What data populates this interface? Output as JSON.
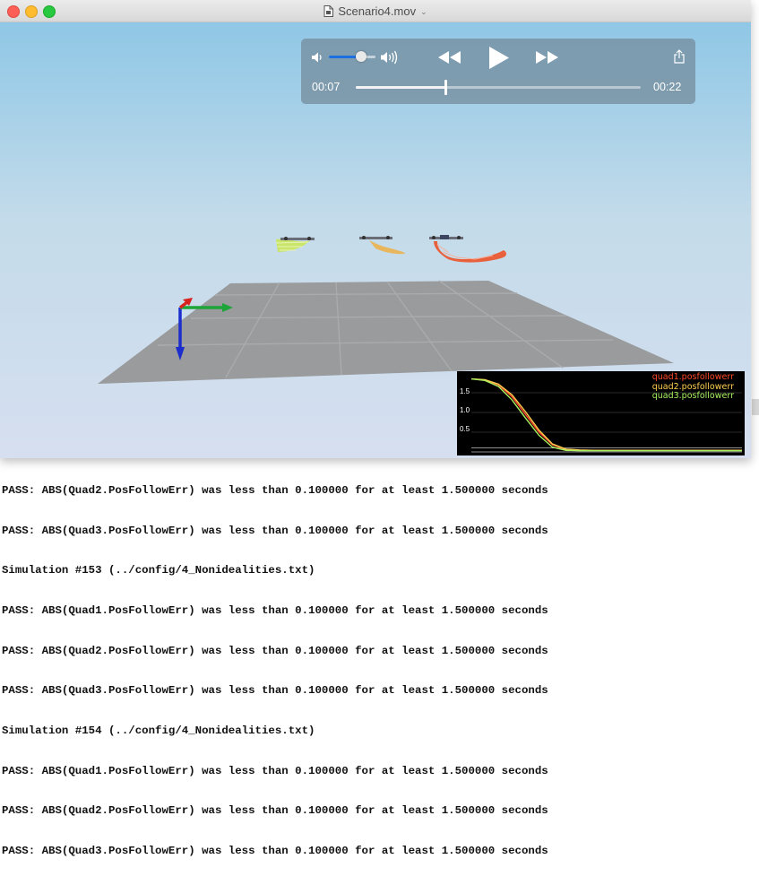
{
  "window": {
    "title": "Scenario4.mov"
  },
  "player": {
    "current_time": "00:07",
    "total_time": "00:22",
    "progress": 0.3158,
    "volume": 0.7
  },
  "plot": {
    "legend": [
      "quad1.posfollowerr",
      "quad2.posfollowerr",
      "quad3.posfollowerr"
    ],
    "legend_colors": [
      "#ff4a2a",
      "#ffd050",
      "#a8f060"
    ],
    "yticks": [
      "1.5",
      "1.0",
      "0.5"
    ]
  },
  "chart_data": {
    "type": "line",
    "title": "",
    "xlabel": "",
    "ylabel": "",
    "ylim": [
      0,
      2
    ],
    "x": [
      0,
      0.05,
      0.1,
      0.15,
      0.2,
      0.25,
      0.3,
      0.35,
      0.4,
      0.45,
      0.5,
      0.6,
      0.7,
      0.8,
      1.0
    ],
    "series": [
      {
        "name": "quad1.posfollowerr",
        "color": "#ff4a2a",
        "values": [
          1.85,
          1.82,
          1.7,
          1.4,
          0.95,
          0.5,
          0.18,
          0.06,
          0.04,
          0.04,
          0.04,
          0.04,
          0.04,
          0.04,
          0.04
        ]
      },
      {
        "name": "quad2.posfollowerr",
        "color": "#ffd050",
        "values": [
          1.85,
          1.83,
          1.72,
          1.45,
          1.02,
          0.55,
          0.2,
          0.07,
          0.05,
          0.04,
          0.04,
          0.04,
          0.04,
          0.04,
          0.04
        ]
      },
      {
        "name": "quad3.posfollowerr",
        "color": "#a8f060",
        "values": [
          1.85,
          1.81,
          1.66,
          1.32,
          0.86,
          0.42,
          0.12,
          0.04,
          0.03,
          0.03,
          0.03,
          0.03,
          0.03,
          0.03,
          0.03
        ]
      }
    ]
  },
  "terminal": {
    "lines": [
      "PASS: ABS(Quad2.PosFollowErr) was less than 0.100000 for at least 1.500000 seconds",
      "PASS: ABS(Quad3.PosFollowErr) was less than 0.100000 for at least 1.500000 seconds",
      "Simulation #153 (../config/4_Nonidealities.txt)",
      "PASS: ABS(Quad1.PosFollowErr) was less than 0.100000 for at least 1.500000 seconds",
      "PASS: ABS(Quad2.PosFollowErr) was less than 0.100000 for at least 1.500000 seconds",
      "PASS: ABS(Quad3.PosFollowErr) was less than 0.100000 for at least 1.500000 seconds",
      "Simulation #154 (../config/4_Nonidealities.txt)",
      "PASS: ABS(Quad1.PosFollowErr) was less than 0.100000 for at least 1.500000 seconds",
      "PASS: ABS(Quad2.PosFollowErr) was less than 0.100000 for at least 1.500000 seconds",
      "PASS: ABS(Quad3.PosFollowErr) was less than 0.100000 for at least 1.500000 seconds"
    ]
  },
  "icons": {
    "volume_low": "speaker-low-icon",
    "volume_high": "speaker-high-icon",
    "rewind": "rewind-icon",
    "play": "play-icon",
    "fast_forward": "fast-forward-icon",
    "share": "share-icon"
  }
}
